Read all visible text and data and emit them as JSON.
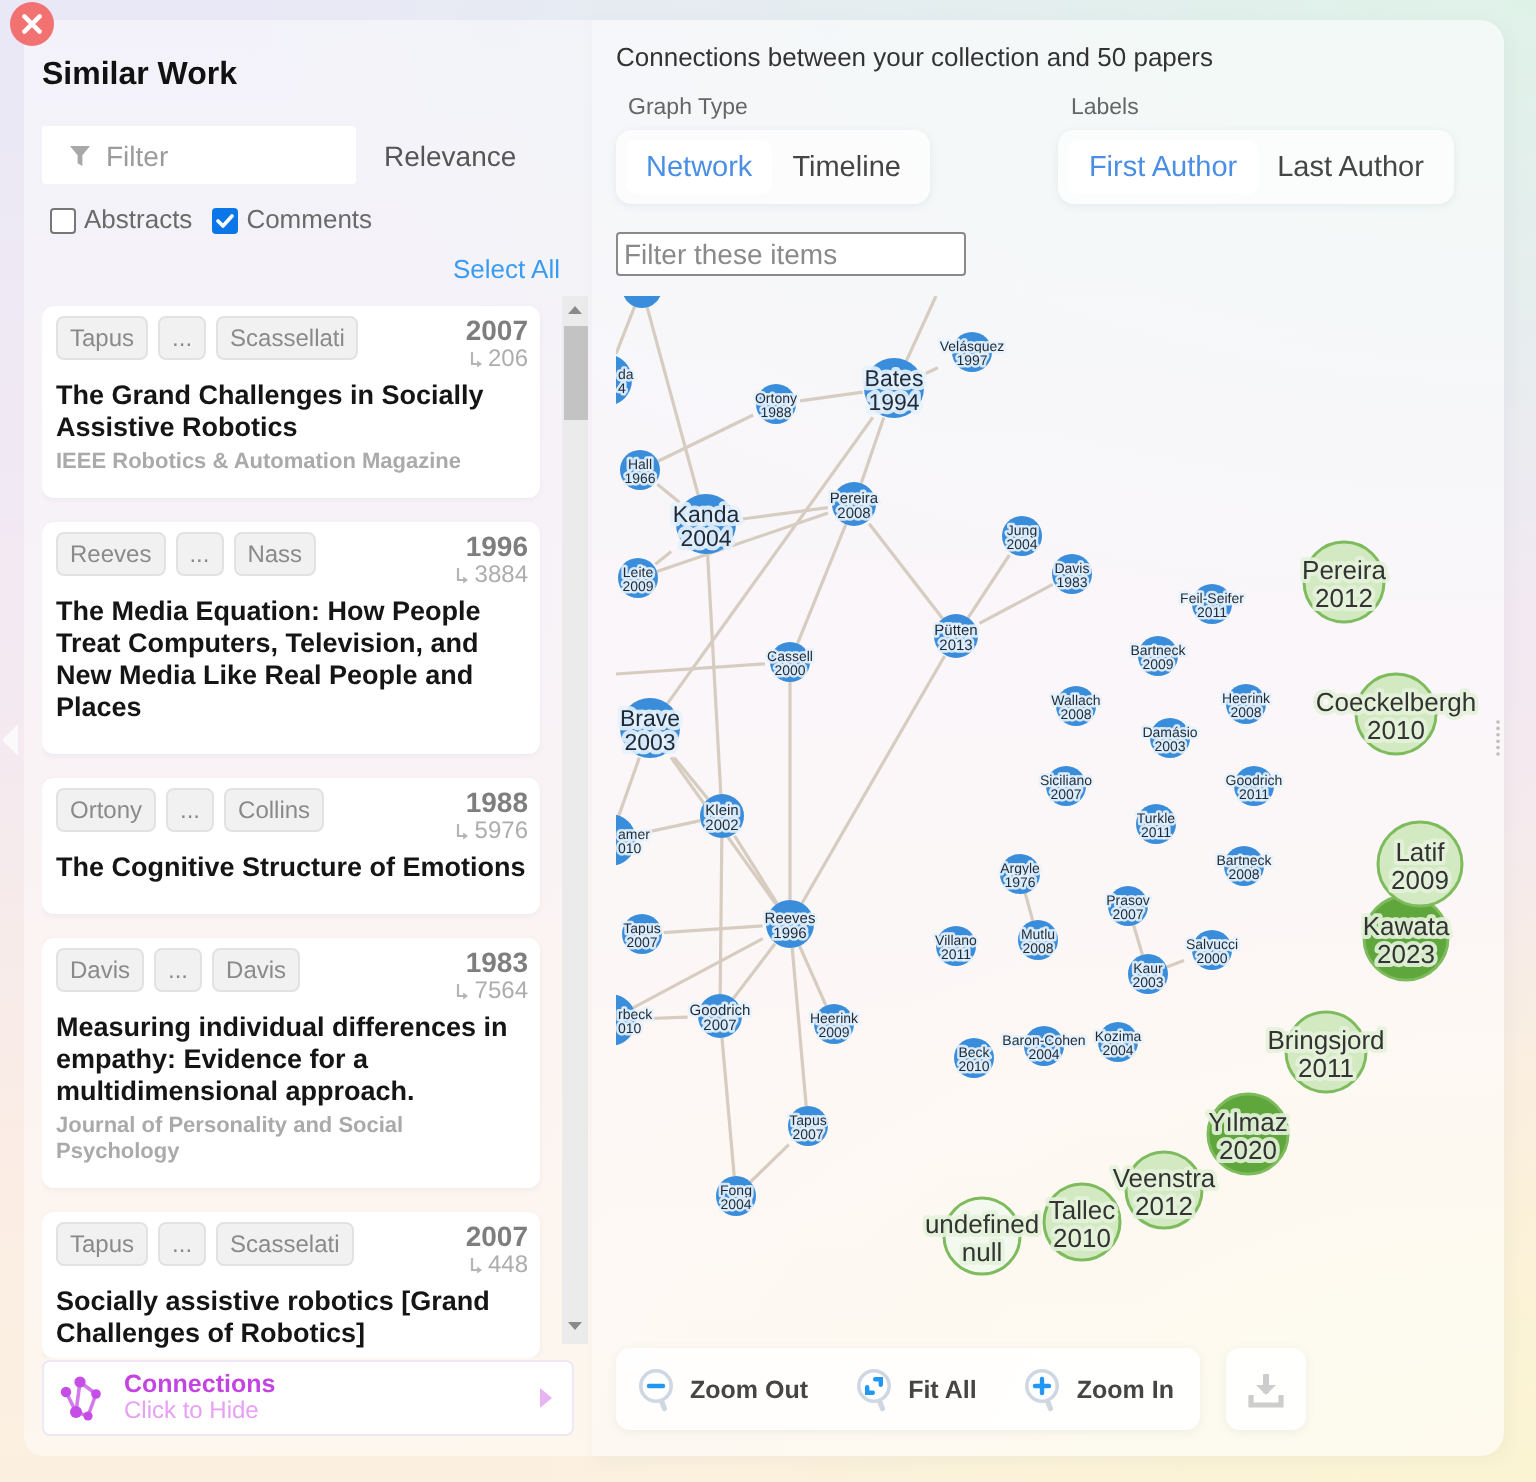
{
  "sidebar": {
    "title": "Similar Work",
    "filter": {
      "placeholder": "Filter"
    },
    "sort": "Relevance",
    "options": [
      {
        "label": "Abstracts",
        "checked": false
      },
      {
        "label": "Comments",
        "checked": true
      }
    ],
    "select_all": "Select All",
    "papers": [
      {
        "authors": [
          "Tapus",
          "...",
          "Scassellati"
        ],
        "year": "2007",
        "citations": "206",
        "title": "The Grand Challenges in Socially Assistive Robotics",
        "venue": "IEEE Robotics & Automation Magazine"
      },
      {
        "authors": [
          "Reeves",
          "...",
          "Nass"
        ],
        "year": "1996",
        "citations": "3884",
        "title": "The Media Equation: How People Treat Computers, Television, and New Media Like Real People and Places"
      },
      {
        "authors": [
          "Ortony",
          "...",
          "Collins"
        ],
        "year": "1988",
        "citations": "5976",
        "title": "The Cognitive Structure of Emotions"
      },
      {
        "authors": [
          "Davis",
          "...",
          "Davis"
        ],
        "year": "1983",
        "citations": "7564",
        "title": "Measuring individual differences in empathy: Evidence for a multidimensional approach.",
        "venue": "Journal of Personality and Social Psychology"
      },
      {
        "authors": [
          "Tapus",
          "...",
          "Scasselati"
        ],
        "year": "2007",
        "citations": "448",
        "title": "Socially assistive robotics [Grand Challenges of Robotics]"
      }
    ],
    "connections": {
      "title": "Connections",
      "hint": "Click to Hide"
    }
  },
  "graph": {
    "summary": "Connections between your collection and 50 papers",
    "graph_type": {
      "label": "Graph Type",
      "options": [
        {
          "label": "Network",
          "selected": true
        },
        {
          "label": "Timeline",
          "selected": false
        }
      ]
    },
    "labels": {
      "label": "Labels",
      "options": [
        {
          "label": "First Author",
          "selected": true
        },
        {
          "label": "Last Author",
          "selected": false
        }
      ]
    },
    "filter": {
      "placeholder": "Filter these items"
    },
    "nodes": [
      {
        "kind": "similar",
        "color": "#3a8ddb"
      },
      {
        "kind": "similar",
        "color": "#3a8ddb",
        "name": "da",
        "year": "4"
      },
      {
        "kind": "similar",
        "color": "#3a8ddb",
        "name": "Ortony",
        "year": "1988"
      },
      {
        "kind": "similar",
        "color": "#3a8ddb",
        "name": "Bates",
        "year": "1994"
      },
      {
        "kind": "similar",
        "color": "#3a8ddb",
        "name": "Velásquez",
        "year": "1997"
      },
      {
        "kind": "similar",
        "color": "#3a8ddb",
        "name": "Hall",
        "year": "1966"
      },
      {
        "kind": "similar",
        "color": "#3a8ddb",
        "name": "Kanda",
        "year": "2004"
      },
      {
        "kind": "similar",
        "color": "#3a8ddb",
        "name": "Pereira",
        "year": "2008"
      },
      {
        "kind": "similar",
        "color": "#3a8ddb",
        "name": "Jung",
        "year": "2004"
      },
      {
        "kind": "similar",
        "color": "#3a8ddb",
        "name": "Leite",
        "year": "2009"
      },
      {
        "kind": "similar",
        "color": "#3a8ddb",
        "name": "Davis",
        "year": "1983"
      },
      {
        "kind": "similar",
        "color": "#3a8ddb",
        "name": "Feil-Seifer",
        "year": "2011"
      },
      {
        "kind": "collection",
        "color": "#d3e9c2",
        "name": "Pereira",
        "year": "2012"
      },
      {
        "kind": "similar",
        "color": "#3a8ddb",
        "name": "Cassell",
        "year": "2000"
      },
      {
        "kind": "similar",
        "color": "#3a8ddb",
        "name": "Pütten",
        "year": "2013"
      },
      {
        "kind": "similar",
        "color": "#3a8ddb",
        "name": "Bartneck",
        "year": "2009"
      },
      {
        "kind": "similar",
        "color": "#3a8ddb",
        "name": "Brave",
        "year": "2003"
      },
      {
        "kind": "similar",
        "color": "#3a8ddb",
        "name": "Wallach",
        "year": "2008"
      },
      {
        "kind": "similar",
        "color": "#3a8ddb",
        "name": "Damásio",
        "year": "2003"
      },
      {
        "kind": "similar",
        "color": "#3a8ddb",
        "name": "Heerink",
        "year": "2008"
      },
      {
        "kind": "collection",
        "color": "#d3e9c2",
        "name": "Coeckelbergh",
        "year": "2010"
      },
      {
        "kind": "similar",
        "color": "#3a8ddb",
        "name": "Klein",
        "year": "2002"
      },
      {
        "kind": "similar",
        "color": "#3a8ddb",
        "name": "Siciliano",
        "year": "2007"
      },
      {
        "kind": "similar",
        "color": "#3a8ddb",
        "name": "Turkle",
        "year": "2011"
      },
      {
        "kind": "similar",
        "color": "#3a8ddb",
        "name": "Goodrich",
        "year": "2011"
      },
      {
        "kind": "similar",
        "color": "#3a8ddb",
        "name": "amer",
        "year": "010"
      },
      {
        "kind": "similar",
        "color": "#3a8ddb",
        "name": "Argyle",
        "year": "1976"
      },
      {
        "kind": "similar",
        "color": "#3a8ddb",
        "name": "Bartneck",
        "year": "2008"
      },
      {
        "kind": "collection",
        "color": "#d3e9c2",
        "name": "Latif",
        "year": "2009"
      },
      {
        "kind": "similar",
        "color": "#3a8ddb",
        "name": "Tapus",
        "year": "2007"
      },
      {
        "kind": "similar",
        "color": "#3a8ddb",
        "name": "Reeves",
        "year": "1996"
      },
      {
        "kind": "similar",
        "color": "#3a8ddb",
        "name": "Villano",
        "year": "2011"
      },
      {
        "kind": "similar",
        "color": "#3a8ddb",
        "name": "Mutlu",
        "year": "2008"
      },
      {
        "kind": "similar",
        "color": "#3a8ddb",
        "name": "Prasov",
        "year": "2007"
      },
      {
        "kind": "similar",
        "color": "#3a8ddb",
        "name": "Kaur",
        "year": "2003"
      },
      {
        "kind": "similar",
        "color": "#3a8ddb",
        "name": "Salvucci",
        "year": "2000"
      },
      {
        "kind": "collection",
        "color": "#5fa63c",
        "name": "Kawata",
        "year": "2023"
      },
      {
        "kind": "similar",
        "color": "#3a8ddb",
        "name": "rbeck",
        "year": "010"
      },
      {
        "kind": "similar",
        "color": "#3a8ddb",
        "name": "Goodrich",
        "year": "2007"
      },
      {
        "kind": "similar",
        "color": "#3a8ddb",
        "name": "Heerink",
        "year": "2009"
      },
      {
        "kind": "similar",
        "color": "#3a8ddb",
        "name": "Beck",
        "year": "2010"
      },
      {
        "kind": "similar",
        "color": "#3a8ddb",
        "name": "Baron-Cohen",
        "year": "2004"
      },
      {
        "kind": "similar",
        "color": "#3a8ddb",
        "name": "Kozima",
        "year": "2004"
      },
      {
        "kind": "collection",
        "color": "#d3e9c2",
        "name": "Bringsjord",
        "year": "2011"
      },
      {
        "kind": "similar",
        "color": "#3a8ddb",
        "name": "Tapus",
        "year": "2007"
      },
      {
        "kind": "collection",
        "color": "#5fa63c",
        "name": "Yılmaz",
        "year": "2020"
      },
      {
        "kind": "similar",
        "color": "#3a8ddb",
        "name": "Fong",
        "year": "2004"
      },
      {
        "kind": "collection",
        "color": "#f4f9ef",
        "name": "undefined",
        "year": "null"
      },
      {
        "kind": "collection",
        "color": "#d3e9c2",
        "name": "Tallec",
        "year": "2010"
      },
      {
        "kind": "collection",
        "color": "#d3e9c2",
        "name": "Veenstra",
        "year": "2012"
      }
    ],
    "toolbar": [
      {
        "kind": "zoom_out",
        "label": "Zoom Out"
      },
      {
        "kind": "fit_all",
        "label": "Fit All"
      },
      {
        "kind": "zoom_in",
        "label": "Zoom In"
      }
    ]
  }
}
